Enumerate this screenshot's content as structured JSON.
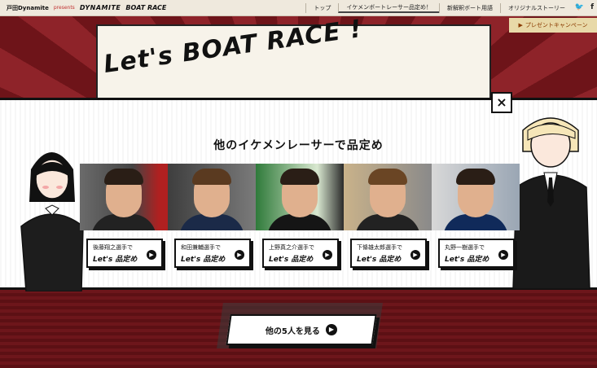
{
  "header": {
    "brand_main": "戸田Dynamite",
    "brand_sub": "presents",
    "brand_dyn": "DYNAMITE",
    "brand_race": "BOAT RACE",
    "nav": [
      "トップ",
      "イケメンボートレーサー品定め！",
      "新解釈ボート用語",
      "オリジナルストーリー"
    ],
    "social": [
      "twitter-icon",
      "facebook-icon"
    ]
  },
  "promo": {
    "label": "プレゼントキャンペーン"
  },
  "background": {
    "title": "Let's BOAT RACE !"
  },
  "modal": {
    "title": "他のイケメンレーサーで品定め",
    "close_label": "×",
    "racers": [
      {
        "name": "後藤翔之選手で",
        "cta": "Let's 品定め"
      },
      {
        "name": "和田兼輔選手で",
        "cta": "Let's 品定め"
      },
      {
        "name": "上野真之介選手で",
        "cta": "Let's 品定め"
      },
      {
        "name": "下條雄太郎選手で",
        "cta": "Let's 品定め"
      },
      {
        "name": "丸野一樹選手で",
        "cta": "Let's 品定め"
      }
    ]
  },
  "see_more": {
    "label": "他の5人を見る"
  },
  "colors": {
    "accent": "#7a1a1f",
    "ink": "#111111"
  }
}
